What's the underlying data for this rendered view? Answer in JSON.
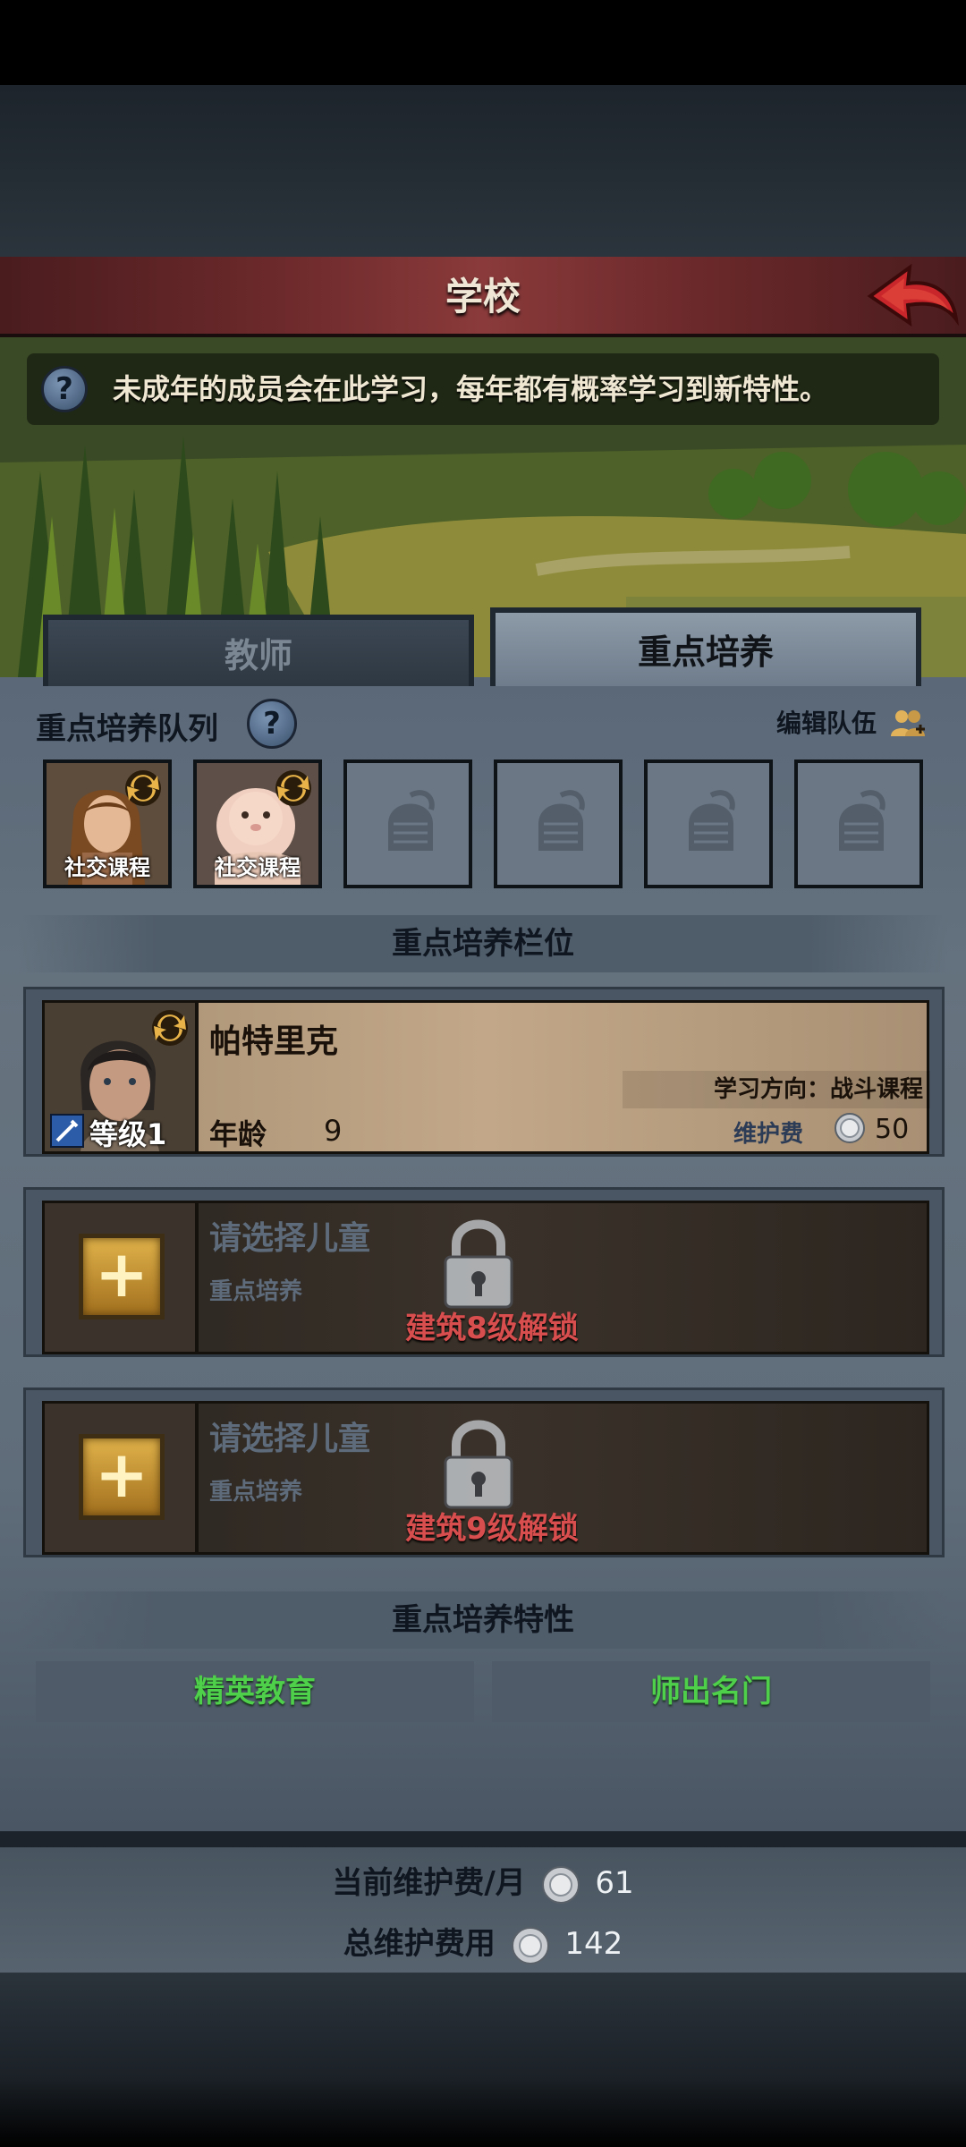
{
  "header": {
    "title": "学校",
    "back_icon": "back-arrow-icon"
  },
  "info": {
    "text": "未成年的成员会在此学习，每年都有概率学习到新特性。",
    "icon": "?"
  },
  "tabs": [
    {
      "label": "教师"
    },
    {
      "label": "重点培养"
    }
  ],
  "queue": {
    "title": "重点培养队列",
    "help_icon": "?",
    "edit_label": "编辑队伍",
    "slots": [
      {
        "label": "社交课程",
        "state": "child"
      },
      {
        "label": "社交课程",
        "state": "baby"
      },
      {
        "state": "empty"
      },
      {
        "state": "empty"
      },
      {
        "state": "empty"
      },
      {
        "state": "empty"
      }
    ]
  },
  "slots_section": {
    "title": "重点培养栏位"
  },
  "focus_slots": [
    {
      "name": "帕特里克",
      "direction": "学习方向：战斗课程",
      "age_label": "年龄",
      "age": "9",
      "level": "等级1",
      "fee_label": "维护费",
      "fee": "50"
    },
    {
      "name": "请选择儿童",
      "sub": "重点培养",
      "plus": "+",
      "lock": "建筑8级解锁"
    },
    {
      "name": "请选择儿童",
      "sub": "重点培养",
      "plus": "+",
      "lock": "建筑9级解锁"
    }
  ],
  "traits_section": {
    "title": "重点培养特性",
    "items": [
      "精英教育",
      "师出名门"
    ]
  },
  "footer": {
    "monthly_label": "当前维护费/月",
    "monthly_value": "61",
    "total_label": "总维护费用",
    "total_value": "142"
  },
  "colors": {
    "trait_text": "#4fd04a",
    "lock_text": "#d84e4e",
    "header": "#6e2a2c"
  }
}
